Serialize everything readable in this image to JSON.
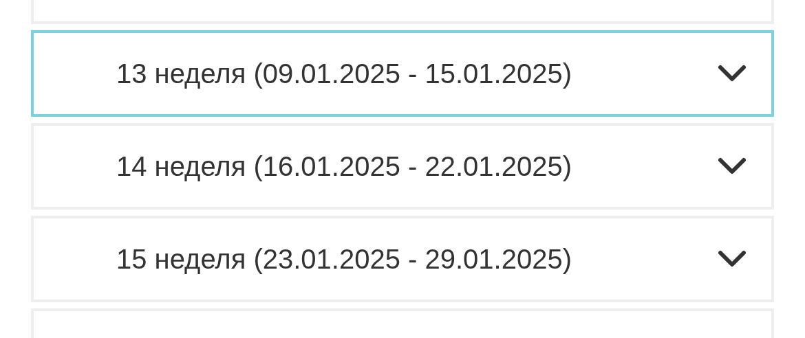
{
  "weeks": [
    {
      "label": "13 неделя (09.01.2025 - 15.01.2025)",
      "selected": true
    },
    {
      "label": "14 неделя (16.01.2025 - 22.01.2025)",
      "selected": false
    },
    {
      "label": "15 неделя (23.01.2025 - 29.01.2025)",
      "selected": false
    }
  ]
}
